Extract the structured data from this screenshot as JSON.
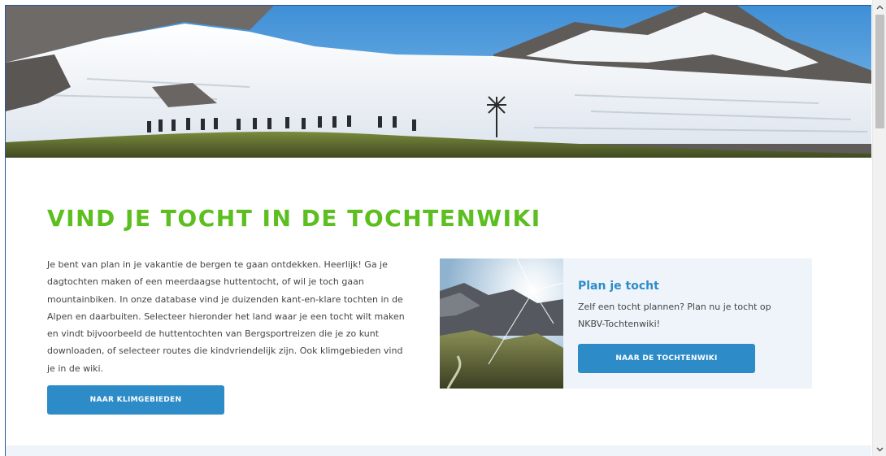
{
  "hero": {
    "image": "mountain-hikers-glacier-photo"
  },
  "main": {
    "title": "VIND JE TOCHT IN DE TOCHTENWIKI",
    "intro_lines": [
      "Je bent van plan in je vakantie de bergen te gaan ontdekken. Heerlijk! Ga je",
      "dagtochten maken of een meerdaagse huttentocht, of wil je toch gaan",
      "mountainbiken. In onze database vind je duizenden kant-en-klare tochten in de",
      "Alpen en daarbuiten. Selecteer hieronder het land waar je een tocht wilt maken",
      "en vindt bijvoorbeeld de huttentochten van Bergsportreizen die je zo kunt",
      "downloaden, of selecteer routes die kindvriendelijk zijn. Ook klimgebieden vind",
      "je in de wiki."
    ],
    "klim_button": "NAAR KLIMGEBIEDEN"
  },
  "card": {
    "image": "mountain-sunburst-photo",
    "title": "Plan je tocht",
    "text_lines": [
      "Zelf een tocht plannen? Plan nu je tocht op",
      "NKBV-Tochtenwiki!"
    ],
    "button": "NAAR DE TOCHTENWIKI"
  },
  "colors": {
    "accent_green": "#5cbf1f",
    "accent_blue": "#2d8cc8",
    "card_bg": "#eef4fa"
  },
  "scrollbar": {
    "up_icon": "chevron-up-icon",
    "down_icon": "chevron-down-icon"
  }
}
